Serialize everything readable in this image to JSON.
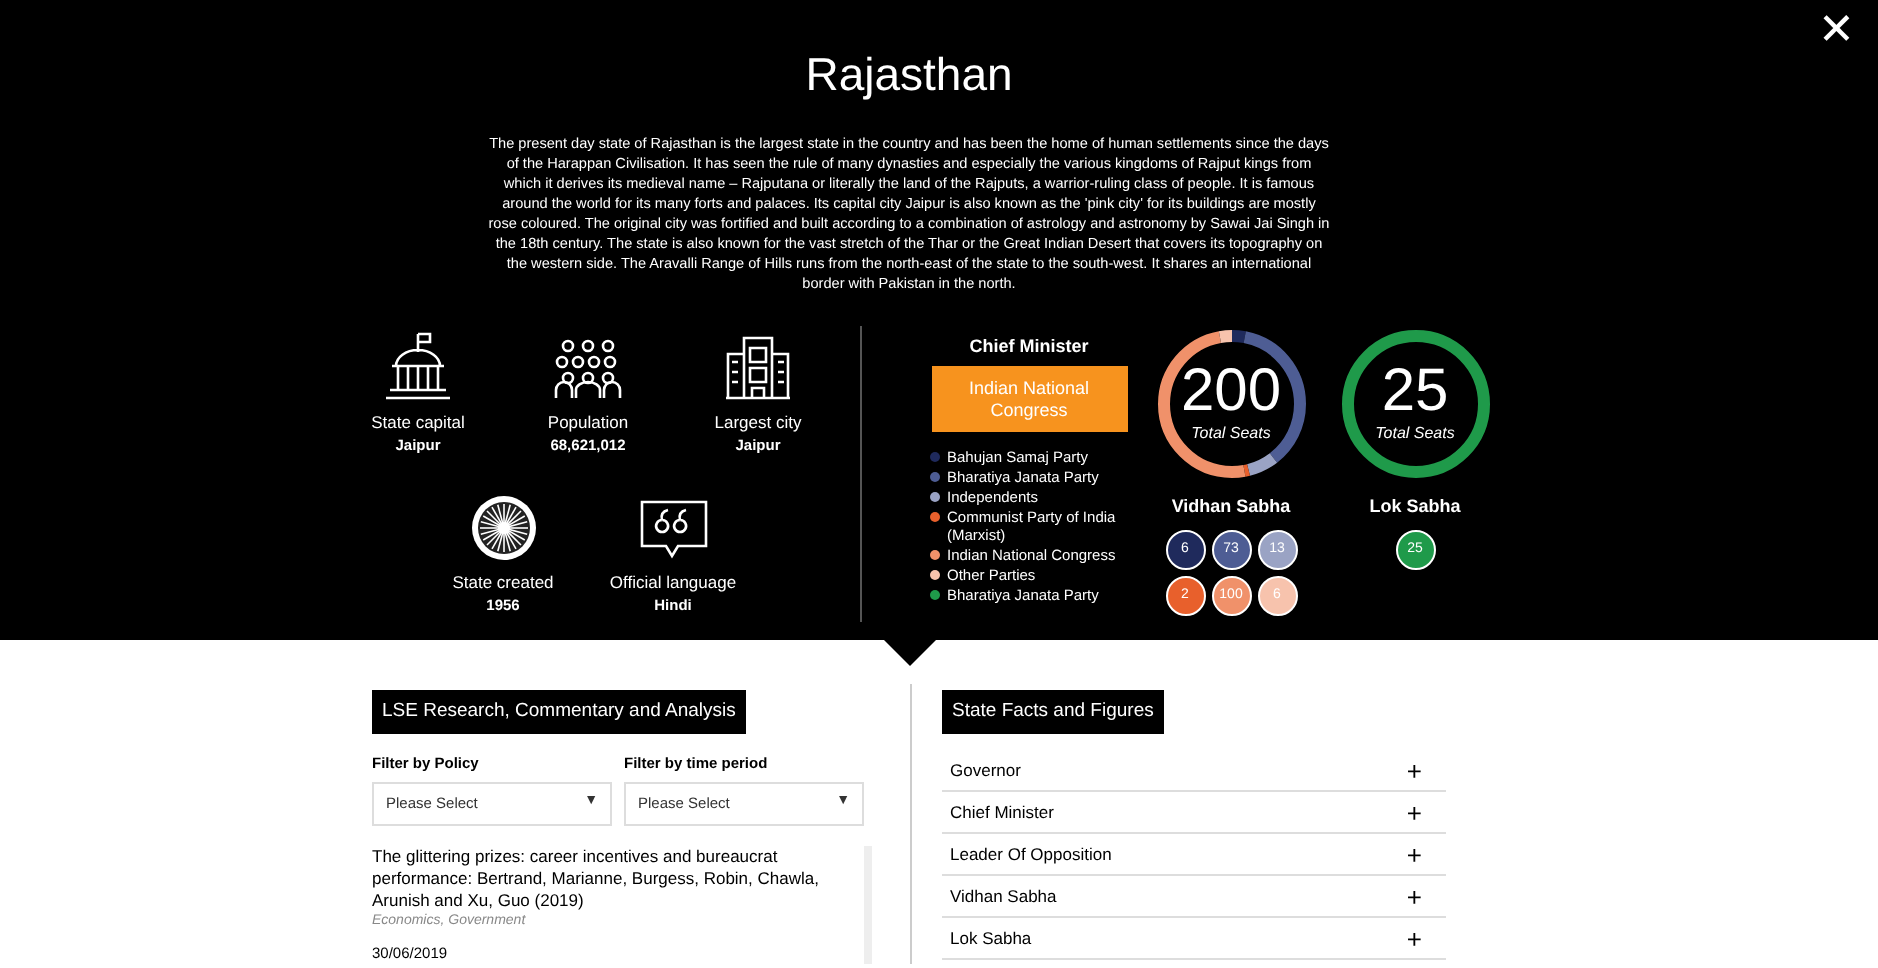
{
  "title": "Rajasthan",
  "close_label": "✕",
  "description": "The present day state of Rajasthan is the largest state in the country and has been the home of human settlements since the days of the Harappan Civilisation. It has seen the rule of many dynasties and especially the various kingdoms of Rajput kings from which it derives its medieval name – Rajputana or literally the land of the Rajputs, a warrior-ruling class of people. It is famous around the world for its many forts and palaces. Its capital city Jaipur is also known as the 'pink city' for its buildings are mostly rose coloured. The original city was fortified and built according to a combination of astrology and astronomy by Sawai Jai Singh in the 18th century. The state is also known for the vast stretch of the Thar or the Great Indian Desert that covers its topography on the western side. The Aravalli Range of Hills runs from the north-east of the state to the south-west. It shares an international border with Pakistan in the north.",
  "facts": [
    {
      "kind": "capitol",
      "label": "State capital",
      "value": "Jaipur"
    },
    {
      "kind": "people",
      "label": "Population",
      "value": "68,621,012"
    },
    {
      "kind": "city",
      "label": "Largest city",
      "value": "Jaipur"
    },
    {
      "kind": "wheel",
      "label": "State created",
      "value": "1956"
    },
    {
      "kind": "speech",
      "label": "Official language",
      "value": "Hindi"
    }
  ],
  "chief_minister": {
    "heading": "Chief Minister",
    "party": "Indian National Congress",
    "color": "#f7931e"
  },
  "parties": [
    {
      "name": "Bahujan Samaj Party",
      "color": "#1f2a5c"
    },
    {
      "name": "Bharatiya Janata Party",
      "color": "#4e5d94"
    },
    {
      "name": "Independents",
      "color": "#9aa3c4"
    },
    {
      "name": "Communist Party of India (Marxist)",
      "color": "#e8602c"
    },
    {
      "name": "Indian National Congress",
      "color": "#f0916a"
    },
    {
      "name": "Other Parties",
      "color": "#f7c3ad"
    },
    {
      "name": "Bharatiya Janata Party",
      "color": "#1f9a4a"
    }
  ],
  "houses": [
    {
      "name": "Vidhan Sabha",
      "total": "200",
      "total_label": "Total Seats",
      "seats": [
        {
          "count": "6",
          "color": "#1f2a5c"
        },
        {
          "count": "73",
          "color": "#4e5d94"
        },
        {
          "count": "13",
          "color": "#9aa3c4"
        },
        {
          "count": "2",
          "color": "#e8602c"
        },
        {
          "count": "100",
          "color": "#f0916a"
        },
        {
          "count": "6",
          "color": "#f7c3ad"
        }
      ]
    },
    {
      "name": "Lok Sabha",
      "total": "25",
      "total_label": "Total Seats",
      "seats": [
        {
          "count": "25",
          "color": "#1f9a4a"
        }
      ]
    }
  ],
  "research": {
    "heading": "LSE Research, Commentary and Analysis",
    "filters": [
      {
        "label": "Filter by Policy",
        "value": "Please Select",
        "caret": "▼"
      },
      {
        "label": "Filter by time period",
        "value": "Please Select",
        "caret": "▼"
      }
    ],
    "articles": [
      {
        "title": "The glittering prizes: career incentives and bureaucrat performance: Bertrand, Marianne, Burgess, Robin, Chawla, Arunish and Xu, Guo (2019)",
        "tags": "Economics, Government",
        "date": "30/06/2019"
      }
    ]
  },
  "state_facts": {
    "heading": "State Facts and Figures",
    "items": [
      {
        "label": "Governor",
        "expanded": false,
        "icon": "+"
      },
      {
        "label": "Chief Minister",
        "expanded": false,
        "icon": "+"
      },
      {
        "label": "Leader Of Opposition",
        "expanded": false,
        "icon": "+"
      },
      {
        "label": "Vidhan Sabha",
        "expanded": false,
        "icon": "+"
      },
      {
        "label": "Lok Sabha",
        "expanded": false,
        "icon": "+"
      }
    ]
  }
}
